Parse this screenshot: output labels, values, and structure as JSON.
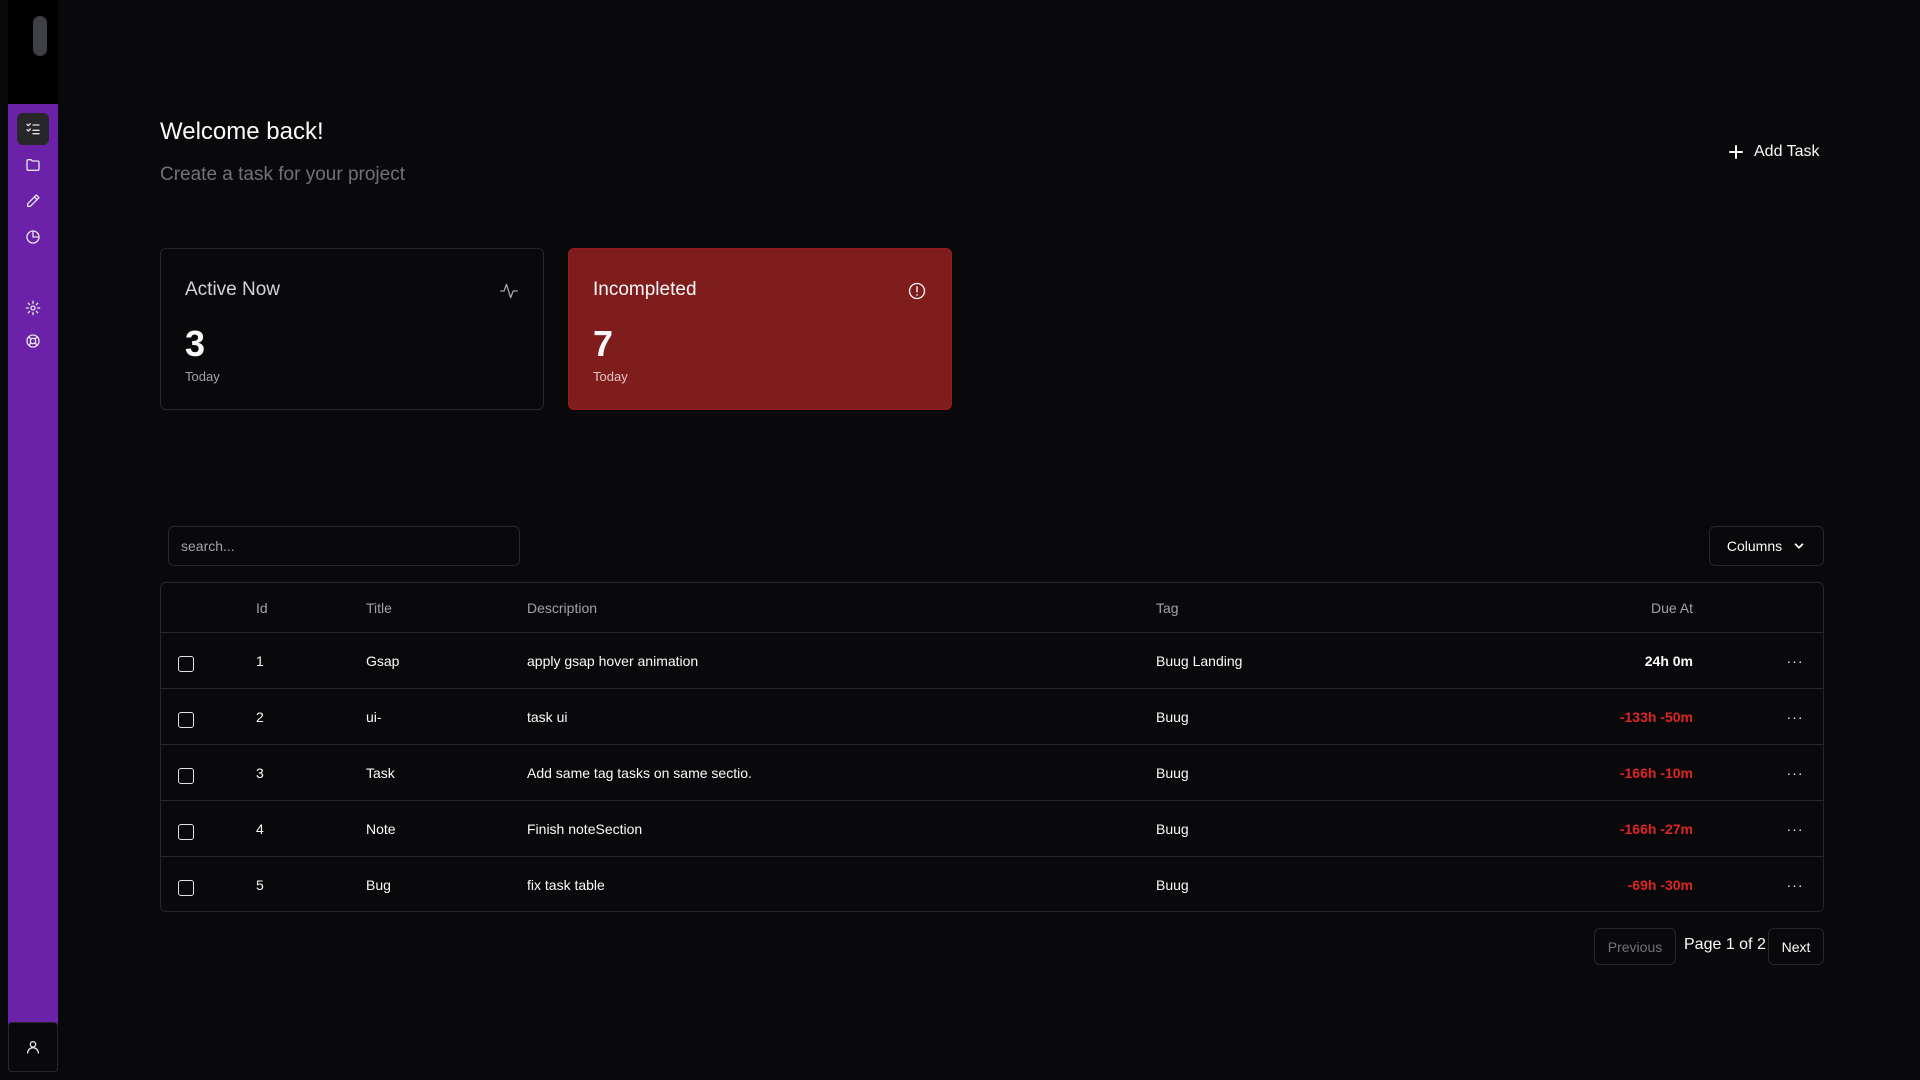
{
  "header": {
    "title": "Welcome back!",
    "subtitle": "Create a task for your project",
    "add_task_label": "Add Task"
  },
  "sidebar": {
    "icons": [
      "tasks-icon",
      "folder-icon",
      "pencil-icon",
      "pie-chart-icon",
      "settings-icon",
      "help-icon"
    ],
    "active": "tasks-icon",
    "footer_icon": "user-icon",
    "accent_color": "#6b21a8"
  },
  "cards": {
    "active": {
      "title": "Active Now",
      "value": "3",
      "sub": "Today",
      "icon": "activity-icon"
    },
    "incompleted": {
      "title": "Incompleted",
      "value": "7",
      "sub": "Today",
      "icon": "alert-circle-icon",
      "color": "#7f1d1d"
    }
  },
  "toolbar": {
    "search_placeholder": "search...",
    "columns_label": "Columns"
  },
  "table": {
    "headers": {
      "id": "Id",
      "title": "Title",
      "description": "Description",
      "tag": "Tag",
      "due": "Due At"
    },
    "rows": [
      {
        "id": "1",
        "title": "Gsap",
        "description": "apply gsap hover animation",
        "tag": "Buug Landing",
        "due": "24h 0m",
        "overdue": false
      },
      {
        "id": "2",
        "title": "ui-",
        "description": "task ui",
        "tag": "Buug",
        "due": "-133h -50m",
        "overdue": true
      },
      {
        "id": "3",
        "title": "Task",
        "description": "Add same tag tasks on same sectio.",
        "tag": "Buug",
        "due": "-166h -10m",
        "overdue": true
      },
      {
        "id": "4",
        "title": "Note",
        "description": "Finish noteSection",
        "tag": "Buug",
        "due": "-166h -27m",
        "overdue": true
      },
      {
        "id": "5",
        "title": "Bug",
        "description": "fix task table",
        "tag": "Buug",
        "due": "-69h -30m",
        "overdue": true
      }
    ],
    "row_action": "···"
  },
  "pagination": {
    "previous_label": "Previous",
    "page_label": "Page 1 of 2",
    "next_label": "Next"
  }
}
